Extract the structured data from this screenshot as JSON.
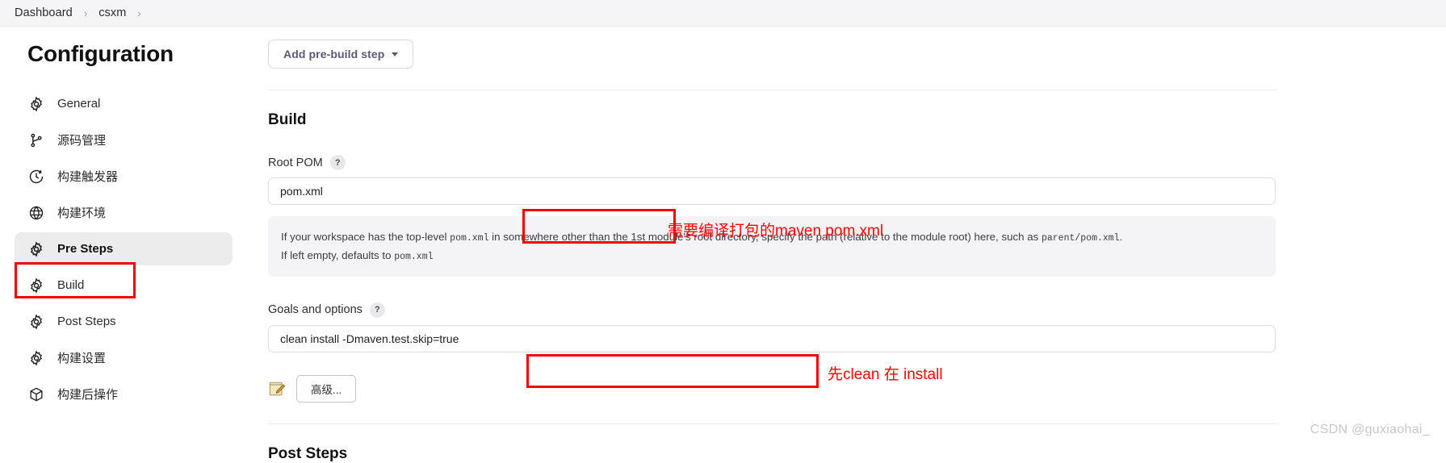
{
  "breadcrumb": {
    "items": [
      "Dashboard",
      "csxm"
    ],
    "separator": "›"
  },
  "sidebar": {
    "title": "Configuration",
    "items": [
      {
        "label": "General",
        "icon": "gear-icon",
        "selected": false
      },
      {
        "label": "源码管理",
        "icon": "branch-icon",
        "selected": false
      },
      {
        "label": "构建触发器",
        "icon": "clock-icon",
        "selected": false
      },
      {
        "label": "构建环境",
        "icon": "globe-icon",
        "selected": false
      },
      {
        "label": "Pre Steps",
        "icon": "gear-icon",
        "selected": true
      },
      {
        "label": "Build",
        "icon": "gear-icon",
        "selected": false
      },
      {
        "label": "Post Steps",
        "icon": "gear-icon",
        "selected": false
      },
      {
        "label": "构建设置",
        "icon": "gear-icon",
        "selected": false
      },
      {
        "label": "构建后操作",
        "icon": "package-icon",
        "selected": false
      }
    ]
  },
  "main": {
    "add_pre_build_step_label": "Add pre-build step",
    "build_heading": "Build",
    "post_steps_heading": "Post Steps",
    "root_pom": {
      "label": "Root POM",
      "help_badge": "?",
      "value": "pom.xml",
      "placeholder": "",
      "help_line1_a": "If your workspace has the top-level ",
      "help_line1_code1": "pom.xml",
      "help_line1_b": " in somewhere other than the 1st module's root directory, specify the path (relative to the module root) here, such as ",
      "help_line1_code2": "parent/pom.xml",
      "help_line1_c": ".",
      "help_line2_a": "If left empty, defaults to ",
      "help_line2_code": "pom.xml"
    },
    "goals": {
      "label": "Goals and options",
      "help_badge": "?",
      "value": "clean install -Dmaven.test.skip=true",
      "placeholder": ""
    },
    "advanced_button_label": "高级..."
  },
  "annotations": {
    "root_pom_note": "需要编译打包的maven pom.xml",
    "goals_note": "先clean 在 install",
    "color": "#ff0000"
  },
  "watermark": "CSDN @guxiaohai_"
}
